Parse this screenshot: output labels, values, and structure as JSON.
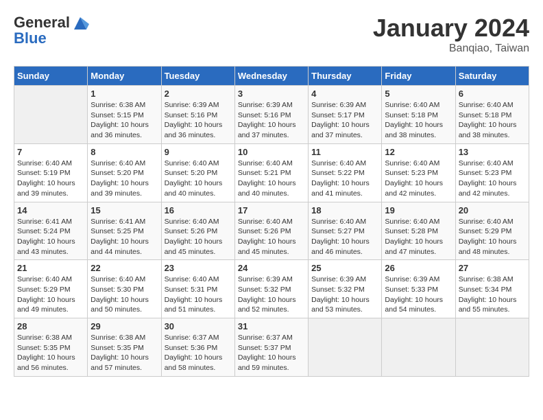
{
  "header": {
    "logo_line1": "General",
    "logo_line2": "Blue",
    "month": "January 2024",
    "location": "Banqiao, Taiwan"
  },
  "weekdays": [
    "Sunday",
    "Monday",
    "Tuesday",
    "Wednesday",
    "Thursday",
    "Friday",
    "Saturday"
  ],
  "weeks": [
    [
      {
        "day": "",
        "empty": true
      },
      {
        "day": "1",
        "sunrise": "6:38 AM",
        "sunset": "5:15 PM",
        "daylight": "10 hours and 36 minutes."
      },
      {
        "day": "2",
        "sunrise": "6:39 AM",
        "sunset": "5:16 PM",
        "daylight": "10 hours and 36 minutes."
      },
      {
        "day": "3",
        "sunrise": "6:39 AM",
        "sunset": "5:16 PM",
        "daylight": "10 hours and 37 minutes."
      },
      {
        "day": "4",
        "sunrise": "6:39 AM",
        "sunset": "5:17 PM",
        "daylight": "10 hours and 37 minutes."
      },
      {
        "day": "5",
        "sunrise": "6:40 AM",
        "sunset": "5:18 PM",
        "daylight": "10 hours and 38 minutes."
      },
      {
        "day": "6",
        "sunrise": "6:40 AM",
        "sunset": "5:18 PM",
        "daylight": "10 hours and 38 minutes."
      }
    ],
    [
      {
        "day": "7",
        "sunrise": "6:40 AM",
        "sunset": "5:19 PM",
        "daylight": "10 hours and 39 minutes."
      },
      {
        "day": "8",
        "sunrise": "6:40 AM",
        "sunset": "5:20 PM",
        "daylight": "10 hours and 39 minutes."
      },
      {
        "day": "9",
        "sunrise": "6:40 AM",
        "sunset": "5:20 PM",
        "daylight": "10 hours and 40 minutes."
      },
      {
        "day": "10",
        "sunrise": "6:40 AM",
        "sunset": "5:21 PM",
        "daylight": "10 hours and 40 minutes."
      },
      {
        "day": "11",
        "sunrise": "6:40 AM",
        "sunset": "5:22 PM",
        "daylight": "10 hours and 41 minutes."
      },
      {
        "day": "12",
        "sunrise": "6:40 AM",
        "sunset": "5:23 PM",
        "daylight": "10 hours and 42 minutes."
      },
      {
        "day": "13",
        "sunrise": "6:40 AM",
        "sunset": "5:23 PM",
        "daylight": "10 hours and 42 minutes."
      }
    ],
    [
      {
        "day": "14",
        "sunrise": "6:41 AM",
        "sunset": "5:24 PM",
        "daylight": "10 hours and 43 minutes."
      },
      {
        "day": "15",
        "sunrise": "6:41 AM",
        "sunset": "5:25 PM",
        "daylight": "10 hours and 44 minutes."
      },
      {
        "day": "16",
        "sunrise": "6:40 AM",
        "sunset": "5:26 PM",
        "daylight": "10 hours and 45 minutes."
      },
      {
        "day": "17",
        "sunrise": "6:40 AM",
        "sunset": "5:26 PM",
        "daylight": "10 hours and 45 minutes."
      },
      {
        "day": "18",
        "sunrise": "6:40 AM",
        "sunset": "5:27 PM",
        "daylight": "10 hours and 46 minutes."
      },
      {
        "day": "19",
        "sunrise": "6:40 AM",
        "sunset": "5:28 PM",
        "daylight": "10 hours and 47 minutes."
      },
      {
        "day": "20",
        "sunrise": "6:40 AM",
        "sunset": "5:29 PM",
        "daylight": "10 hours and 48 minutes."
      }
    ],
    [
      {
        "day": "21",
        "sunrise": "6:40 AM",
        "sunset": "5:29 PM",
        "daylight": "10 hours and 49 minutes."
      },
      {
        "day": "22",
        "sunrise": "6:40 AM",
        "sunset": "5:30 PM",
        "daylight": "10 hours and 50 minutes."
      },
      {
        "day": "23",
        "sunrise": "6:40 AM",
        "sunset": "5:31 PM",
        "daylight": "10 hours and 51 minutes."
      },
      {
        "day": "24",
        "sunrise": "6:39 AM",
        "sunset": "5:32 PM",
        "daylight": "10 hours and 52 minutes."
      },
      {
        "day": "25",
        "sunrise": "6:39 AM",
        "sunset": "5:32 PM",
        "daylight": "10 hours and 53 minutes."
      },
      {
        "day": "26",
        "sunrise": "6:39 AM",
        "sunset": "5:33 PM",
        "daylight": "10 hours and 54 minutes."
      },
      {
        "day": "27",
        "sunrise": "6:38 AM",
        "sunset": "5:34 PM",
        "daylight": "10 hours and 55 minutes."
      }
    ],
    [
      {
        "day": "28",
        "sunrise": "6:38 AM",
        "sunset": "5:35 PM",
        "daylight": "10 hours and 56 minutes."
      },
      {
        "day": "29",
        "sunrise": "6:38 AM",
        "sunset": "5:35 PM",
        "daylight": "10 hours and 57 minutes."
      },
      {
        "day": "30",
        "sunrise": "6:37 AM",
        "sunset": "5:36 PM",
        "daylight": "10 hours and 58 minutes."
      },
      {
        "day": "31",
        "sunrise": "6:37 AM",
        "sunset": "5:37 PM",
        "daylight": "10 hours and 59 minutes."
      },
      {
        "day": "",
        "empty": true
      },
      {
        "day": "",
        "empty": true
      },
      {
        "day": "",
        "empty": true
      }
    ]
  ],
  "labels": {
    "sunrise": "Sunrise:",
    "sunset": "Sunset:",
    "daylight": "Daylight:"
  }
}
